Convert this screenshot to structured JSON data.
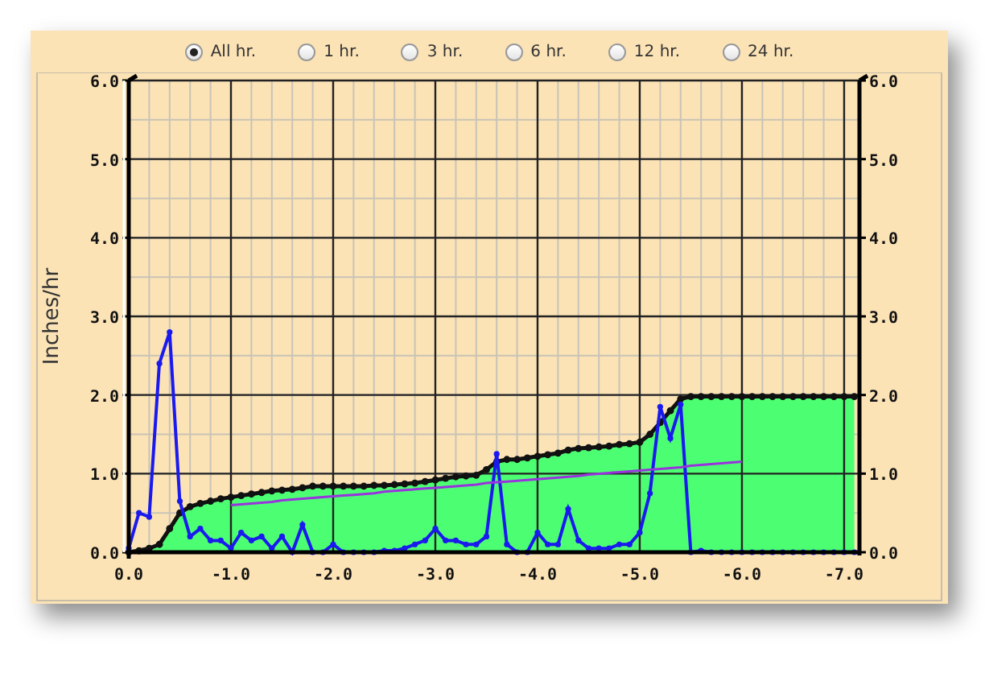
{
  "range_options": [
    {
      "label": "All hr.",
      "selected": true
    },
    {
      "label": "1 hr.",
      "selected": false
    },
    {
      "label": "3 hr.",
      "selected": false
    },
    {
      "label": "6 hr.",
      "selected": false
    },
    {
      "label": "12 hr.",
      "selected": false
    },
    {
      "label": "24 hr.",
      "selected": false
    }
  ],
  "chart": {
    "chart_data": {
      "type": "line",
      "grid": true,
      "ylabel": "Inches/hr",
      "xlim": [
        0,
        -7.15
      ],
      "ylim": [
        0,
        6
      ],
      "xticks": [
        {
          "value": 0,
          "label": "0.0"
        },
        {
          "value": -1,
          "label": "-1.0"
        },
        {
          "value": -2,
          "label": "-2.0"
        },
        {
          "value": -3,
          "label": "-3.0"
        },
        {
          "value": -4,
          "label": "-4.0"
        },
        {
          "value": -5,
          "label": "-5.0"
        },
        {
          "value": -6,
          "label": "-6.0"
        },
        {
          "value": -7,
          "label": "-7.0"
        }
      ],
      "yticks": [
        {
          "value": 0,
          "label": "0.0"
        },
        {
          "value": 1,
          "label": "1.0"
        },
        {
          "value": 2,
          "label": "2.0"
        },
        {
          "value": 3,
          "label": "3.0"
        },
        {
          "value": 4,
          "label": "4.0"
        },
        {
          "value": 5,
          "label": "5.0"
        },
        {
          "value": 6,
          "label": "6.0"
        }
      ],
      "x": [
        0,
        -0.1,
        -0.2,
        -0.3,
        -0.4,
        -0.5,
        -0.6,
        -0.7,
        -0.8,
        -0.9,
        -1.0,
        -1.1,
        -1.2,
        -1.3,
        -1.4,
        -1.5,
        -1.6,
        -1.7,
        -1.8,
        -1.9,
        -2.0,
        -2.1,
        -2.2,
        -2.3,
        -2.4,
        -2.5,
        -2.6,
        -2.7,
        -2.8,
        -2.9,
        -3.0,
        -3.1,
        -3.2,
        -3.3,
        -3.4,
        -3.5,
        -3.6,
        -3.7,
        -3.8,
        -3.9,
        -4.0,
        -4.1,
        -4.2,
        -4.3,
        -4.4,
        -4.5,
        -4.6,
        -4.7,
        -4.8,
        -4.9,
        -5.0,
        -5.1,
        -5.2,
        -5.3,
        -5.4,
        -5.5,
        -5.6,
        -5.7,
        -5.8,
        -5.9,
        -6.0,
        -6.1,
        -6.2,
        -6.3,
        -6.4,
        -6.5,
        -6.6,
        -6.7,
        -6.8,
        -6.9,
        -7.0,
        -7.1
      ],
      "series": [
        {
          "type": "area",
          "color": "#111111",
          "marker": true,
          "values": [
            0,
            0.02,
            0.05,
            0.1,
            0.3,
            0.5,
            0.58,
            0.62,
            0.65,
            0.68,
            0.7,
            0.72,
            0.74,
            0.76,
            0.78,
            0.79,
            0.8,
            0.82,
            0.84,
            0.84,
            0.84,
            0.84,
            0.84,
            0.84,
            0.85,
            0.85,
            0.86,
            0.87,
            0.88,
            0.9,
            0.92,
            0.94,
            0.96,
            0.97,
            0.98,
            1.05,
            1.15,
            1.18,
            1.18,
            1.2,
            1.22,
            1.24,
            1.26,
            1.3,
            1.32,
            1.33,
            1.34,
            1.35,
            1.37,
            1.38,
            1.4,
            1.5,
            1.65,
            1.8,
            1.95,
            1.98,
            1.98,
            1.98,
            1.98,
            1.98,
            1.98,
            1.98,
            1.98,
            1.98,
            1.98,
            1.98,
            1.98,
            1.98,
            1.98,
            1.98,
            1.98,
            1.98
          ]
        },
        {
          "type": "line",
          "color": "#1a1aee",
          "marker": true,
          "values": [
            0.05,
            0.5,
            0.45,
            2.4,
            2.8,
            0.65,
            0.2,
            0.3,
            0.15,
            0.15,
            0.05,
            0.25,
            0.15,
            0.2,
            0.05,
            0.2,
            0,
            0.35,
            0,
            0,
            0.1,
            0,
            0,
            0,
            0,
            0.02,
            0.02,
            0.05,
            0.1,
            0.15,
            0.3,
            0.15,
            0.15,
            0.1,
            0.1,
            0.2,
            1.25,
            0.1,
            0,
            0,
            0.25,
            0.1,
            0.1,
            0.55,
            0.15,
            0.05,
            0.05,
            0.05,
            0.1,
            0.1,
            0.25,
            0.75,
            1.85,
            1.45,
            1.88,
            0,
            0.02,
            0,
            0,
            0,
            0,
            0,
            0,
            0,
            0,
            0,
            0,
            0,
            0,
            0,
            0,
            0
          ]
        },
        {
          "type": "line",
          "color": "#9933dd",
          "marker": false,
          "values": [
            null,
            null,
            null,
            null,
            null,
            null,
            null,
            null,
            null,
            null,
            0.6,
            0.61,
            0.62,
            0.63,
            0.64,
            0.66,
            0.67,
            0.68,
            0.69,
            0.7,
            0.71,
            0.72,
            0.73,
            0.74,
            0.75,
            0.77,
            0.78,
            0.79,
            0.8,
            0.81,
            0.82,
            0.83,
            0.84,
            0.85,
            0.86,
            0.88,
            0.89,
            0.9,
            0.91,
            0.92,
            0.93,
            0.94,
            0.95,
            0.96,
            0.97,
            0.99,
            1.0,
            1.01,
            1.02,
            1.03,
            1.04,
            1.05,
            1.06,
            1.07,
            1.08,
            1.1,
            1.11,
            1.12,
            1.13,
            1.14,
            1.15,
            null,
            null,
            null,
            null,
            null,
            null,
            null,
            null,
            null,
            null,
            null
          ]
        }
      ]
    }
  }
}
